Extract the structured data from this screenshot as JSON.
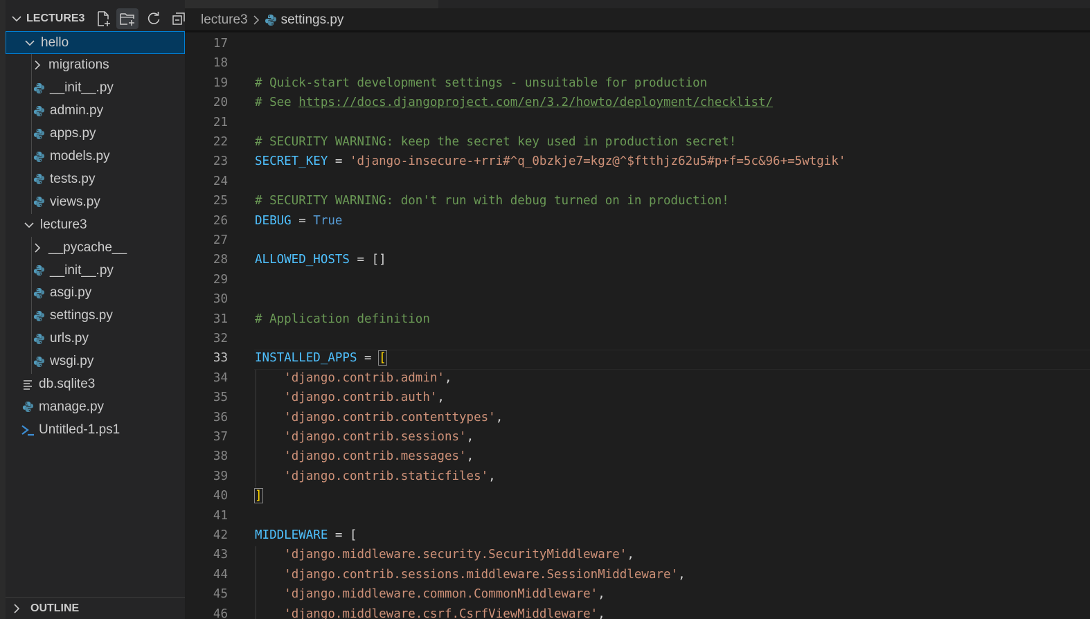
{
  "explorer": {
    "title": "LECTURE3",
    "actions": [
      "new-file-icon",
      "new-folder-icon",
      "refresh-icon",
      "collapse-all-icon"
    ],
    "items": [
      {
        "label": "hello",
        "kind": "folder",
        "expanded": true,
        "selected": true,
        "depth": 0
      },
      {
        "label": "migrations",
        "kind": "folder",
        "expanded": false,
        "depth": 1
      },
      {
        "label": "__init__.py",
        "kind": "python",
        "depth": 1
      },
      {
        "label": "admin.py",
        "kind": "python",
        "depth": 1
      },
      {
        "label": "apps.py",
        "kind": "python",
        "depth": 1
      },
      {
        "label": "models.py",
        "kind": "python",
        "depth": 1
      },
      {
        "label": "tests.py",
        "kind": "python",
        "depth": 1
      },
      {
        "label": "views.py",
        "kind": "python",
        "depth": 1
      },
      {
        "label": "lecture3",
        "kind": "folder",
        "expanded": true,
        "depth": 0
      },
      {
        "label": "__pycache__",
        "kind": "folder",
        "expanded": false,
        "depth": 1
      },
      {
        "label": "__init__.py",
        "kind": "python",
        "depth": 1
      },
      {
        "label": "asgi.py",
        "kind": "python",
        "depth": 1
      },
      {
        "label": "settings.py",
        "kind": "python",
        "depth": 1
      },
      {
        "label": "urls.py",
        "kind": "python",
        "depth": 1
      },
      {
        "label": "wsgi.py",
        "kind": "python",
        "depth": 1
      },
      {
        "label": "db.sqlite3",
        "kind": "file",
        "depth": 0
      },
      {
        "label": "manage.py",
        "kind": "python",
        "depth": 0
      },
      {
        "label": "Untitled-1.ps1",
        "kind": "powershell",
        "depth": 0
      }
    ]
  },
  "outline": {
    "label": "OUTLINE"
  },
  "breadcrumb": {
    "folder": "lecture3",
    "file": "settings.py"
  },
  "editor": {
    "current_line": 33,
    "lines": [
      {
        "n": "17",
        "tokens": []
      },
      {
        "n": "18",
        "tokens": []
      },
      {
        "n": "19",
        "tokens": [
          {
            "t": "# Quick-start development settings - unsuitable for production",
            "c": "comment"
          }
        ]
      },
      {
        "n": "20",
        "tokens": [
          {
            "t": "# See ",
            "c": "comment"
          },
          {
            "t": "https://docs.djangoproject.com/en/3.2/howto/deployment/checklist/",
            "c": "link"
          }
        ]
      },
      {
        "n": "21",
        "tokens": []
      },
      {
        "n": "22",
        "tokens": [
          {
            "t": "# SECURITY WARNING: keep the secret key used in production secret!",
            "c": "comment"
          }
        ]
      },
      {
        "n": "23",
        "tokens": [
          {
            "t": "SECRET_KEY",
            "c": "var"
          },
          {
            "t": " = ",
            "c": "op"
          },
          {
            "t": "'django-insecure-+rri#^q_0bzkje7=kgz@^$ftthjz62u5#p+f=5c&96+=5wtgik'",
            "c": "str"
          }
        ]
      },
      {
        "n": "24",
        "tokens": []
      },
      {
        "n": "25",
        "tokens": [
          {
            "t": "# SECURITY WARNING: don't run with debug turned on in production!",
            "c": "comment"
          }
        ]
      },
      {
        "n": "26",
        "tokens": [
          {
            "t": "DEBUG",
            "c": "var"
          },
          {
            "t": " = ",
            "c": "op"
          },
          {
            "t": "True",
            "c": "kw"
          }
        ]
      },
      {
        "n": "27",
        "tokens": []
      },
      {
        "n": "28",
        "tokens": [
          {
            "t": "ALLOWED_HOSTS",
            "c": "var"
          },
          {
            "t": " = ",
            "c": "op"
          },
          {
            "t": "[]",
            "c": "punc"
          }
        ]
      },
      {
        "n": "29",
        "tokens": []
      },
      {
        "n": "30",
        "tokens": []
      },
      {
        "n": "31",
        "tokens": [
          {
            "t": "# Application definition",
            "c": "comment"
          }
        ]
      },
      {
        "n": "32",
        "tokens": []
      },
      {
        "n": "33",
        "tokens": [
          {
            "t": "INSTALLED_APPS",
            "c": "var"
          },
          {
            "t": " = ",
            "c": "op"
          },
          {
            "t": "[",
            "c": "bracket"
          }
        ]
      },
      {
        "n": "34",
        "tokens": [
          {
            "t": "    ",
            "c": "op"
          },
          {
            "t": "'django.contrib.admin'",
            "c": "str"
          },
          {
            "t": ",",
            "c": "punc"
          }
        ]
      },
      {
        "n": "35",
        "tokens": [
          {
            "t": "    ",
            "c": "op"
          },
          {
            "t": "'django.contrib.auth'",
            "c": "str"
          },
          {
            "t": ",",
            "c": "punc"
          }
        ]
      },
      {
        "n": "36",
        "tokens": [
          {
            "t": "    ",
            "c": "op"
          },
          {
            "t": "'django.contrib.contenttypes'",
            "c": "str"
          },
          {
            "t": ",",
            "c": "punc"
          }
        ]
      },
      {
        "n": "37",
        "tokens": [
          {
            "t": "    ",
            "c": "op"
          },
          {
            "t": "'django.contrib.sessions'",
            "c": "str"
          },
          {
            "t": ",",
            "c": "punc"
          }
        ]
      },
      {
        "n": "38",
        "tokens": [
          {
            "t": "    ",
            "c": "op"
          },
          {
            "t": "'django.contrib.messages'",
            "c": "str"
          },
          {
            "t": ",",
            "c": "punc"
          }
        ]
      },
      {
        "n": "39",
        "tokens": [
          {
            "t": "    ",
            "c": "op"
          },
          {
            "t": "'django.contrib.staticfiles'",
            "c": "str"
          },
          {
            "t": ",",
            "c": "punc"
          }
        ]
      },
      {
        "n": "40",
        "tokens": [
          {
            "t": "]",
            "c": "bracket"
          }
        ]
      },
      {
        "n": "41",
        "tokens": []
      },
      {
        "n": "42",
        "tokens": [
          {
            "t": "MIDDLEWARE",
            "c": "var"
          },
          {
            "t": " = ",
            "c": "op"
          },
          {
            "t": "[",
            "c": "punc"
          }
        ]
      },
      {
        "n": "43",
        "tokens": [
          {
            "t": "    ",
            "c": "op"
          },
          {
            "t": "'django.middleware.security.SecurityMiddleware'",
            "c": "str"
          },
          {
            "t": ",",
            "c": "punc"
          }
        ]
      },
      {
        "n": "44",
        "tokens": [
          {
            "t": "    ",
            "c": "op"
          },
          {
            "t": "'django.contrib.sessions.middleware.SessionMiddleware'",
            "c": "str"
          },
          {
            "t": ",",
            "c": "punc"
          }
        ]
      },
      {
        "n": "45",
        "tokens": [
          {
            "t": "    ",
            "c": "op"
          },
          {
            "t": "'django.middleware.common.CommonMiddleware'",
            "c": "str"
          },
          {
            "t": ",",
            "c": "punc"
          }
        ]
      },
      {
        "n": "46",
        "tokens": [
          {
            "t": "    ",
            "c": "op"
          },
          {
            "t": "'django.middleware.csrf.CsrfViewMiddleware'",
            "c": "str"
          },
          {
            "t": ",",
            "c": "punc"
          }
        ]
      }
    ]
  },
  "colors": {
    "background": "#1e1e1e",
    "sidebar": "#252526",
    "selection": "#04395e",
    "focus_border": "#007fd4",
    "comment": "#6a9955",
    "variable": "#4fc1ff",
    "string": "#ce9178",
    "keyword": "#569cd6",
    "python_icon": "#519aba"
  }
}
